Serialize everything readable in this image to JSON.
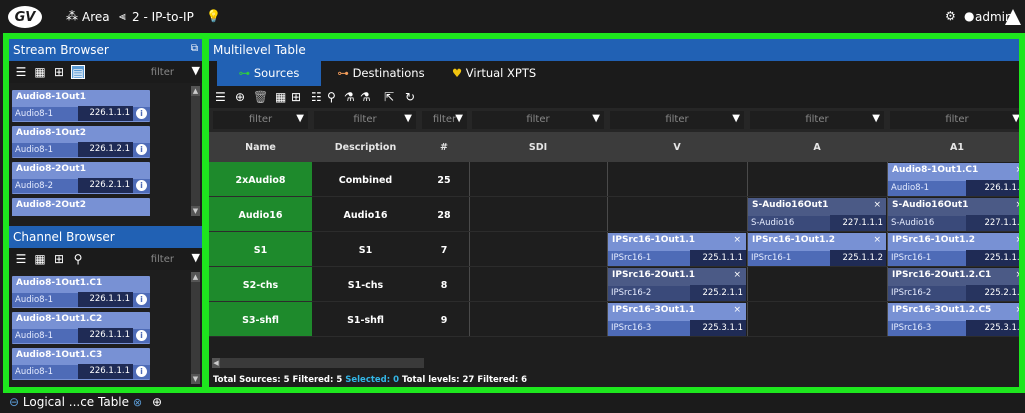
{
  "topbar": {
    "logo": "GV",
    "area_label": "Area",
    "layout_label": "2 - IP-to-IP",
    "user": "admin"
  },
  "stream_browser": {
    "title": "Stream Browser",
    "filter_placeholder": "filter",
    "items": [
      {
        "name": "Audio8-1Out1",
        "sub": "Audio8-1",
        "ip": "226.1.1.1"
      },
      {
        "name": "Audio8-1Out2",
        "sub": "Audio8-1",
        "ip": "226.1.2.1"
      },
      {
        "name": "Audio8-2Out1",
        "sub": "Audio8-2",
        "ip": "226.2.1.1"
      },
      {
        "name": "Audio8-2Out2",
        "sub": "",
        "ip": ""
      }
    ]
  },
  "channel_browser": {
    "title": "Channel Browser",
    "filter_placeholder": "filter",
    "items": [
      {
        "name": "Audio8-1Out1.C1",
        "sub": "Audio8-1",
        "ip": "226.1.1.1"
      },
      {
        "name": "Audio8-1Out1.C2",
        "sub": "Audio8-1",
        "ip": "226.1.1.1"
      },
      {
        "name": "Audio8-1Out1.C3",
        "sub": "Audio8-1",
        "ip": "226.1.1.1"
      }
    ]
  },
  "multilevel": {
    "title": "Multilevel Table",
    "tabs": [
      "Sources",
      "Destinations",
      "Virtual XPTS"
    ],
    "filter_placeholder": "filter",
    "columns": [
      "Name",
      "Description",
      "#",
      "SDI",
      "V",
      "A",
      "A1"
    ],
    "rows": [
      {
        "name": "2xAudio8",
        "desc": "Combined",
        "num": "25"
      },
      {
        "name": "Audio16",
        "desc": "Audio16",
        "num": "28"
      },
      {
        "name": "S1",
        "desc": "S1",
        "num": "7"
      },
      {
        "name": "S2-chs",
        "desc": "S1-chs",
        "num": "8"
      },
      {
        "name": "S3-shfl",
        "desc": "S1-shfl",
        "num": "9"
      }
    ],
    "cells": {
      "r0_a1": {
        "name": "Audio8-1Out1.C1",
        "sub": "Audio8-1",
        "ip": "226.1.1.1"
      },
      "r1_a": {
        "name": "S-Audio16Out1",
        "sub": "S-Audio16",
        "ip": "227.1.1.1"
      },
      "r1_a1": {
        "name": "S-Audio16Out1",
        "sub": "S-Audio16",
        "ip": "227.1.1.1"
      },
      "r2_v": {
        "name": "IPSrc16-1Out1.1",
        "sub": "IPSrc16-1",
        "ip": "225.1.1.1"
      },
      "r2_a": {
        "name": "IPSrc16-1Out1.2",
        "sub": "IPSrc16-1",
        "ip": "225.1.1.2"
      },
      "r2_a1": {
        "name": "IPSrc16-1Out1.2",
        "sub": "IPSrc16-1",
        "ip": "225.1.1.2"
      },
      "r3_v": {
        "name": "IPSrc16-2Out1.1",
        "sub": "IPSrc16-2",
        "ip": "225.2.1.1"
      },
      "r3_a1": {
        "name": "IPSrc16-2Out1.2.C1",
        "sub": "IPSrc16-2",
        "ip": "225.2.1.2"
      },
      "r4_v": {
        "name": "IPSrc16-3Out1.1",
        "sub": "IPSrc16-3",
        "ip": "225.3.1.1"
      },
      "r4_a1": {
        "name": "IPSrc16-3Out1.2.C5",
        "sub": "IPSrc16-3",
        "ip": "225.3.1.2"
      }
    },
    "status": {
      "total_sources": "Total Sources: 5",
      "filtered": "Filtered: 5",
      "selected": "Selected: 0",
      "total_levels": "Total levels: 27",
      "filtered_levels": "Filtered: 6"
    }
  },
  "bottom": {
    "tab_label": "Logical ...ce Table"
  },
  "colors": {
    "frame_green": "#1ee61e",
    "header_blue": "#2161b4",
    "card_blue": "#7891d4",
    "row_green": "#1e8a2c",
    "selected_cyan": "#33b5e5"
  }
}
